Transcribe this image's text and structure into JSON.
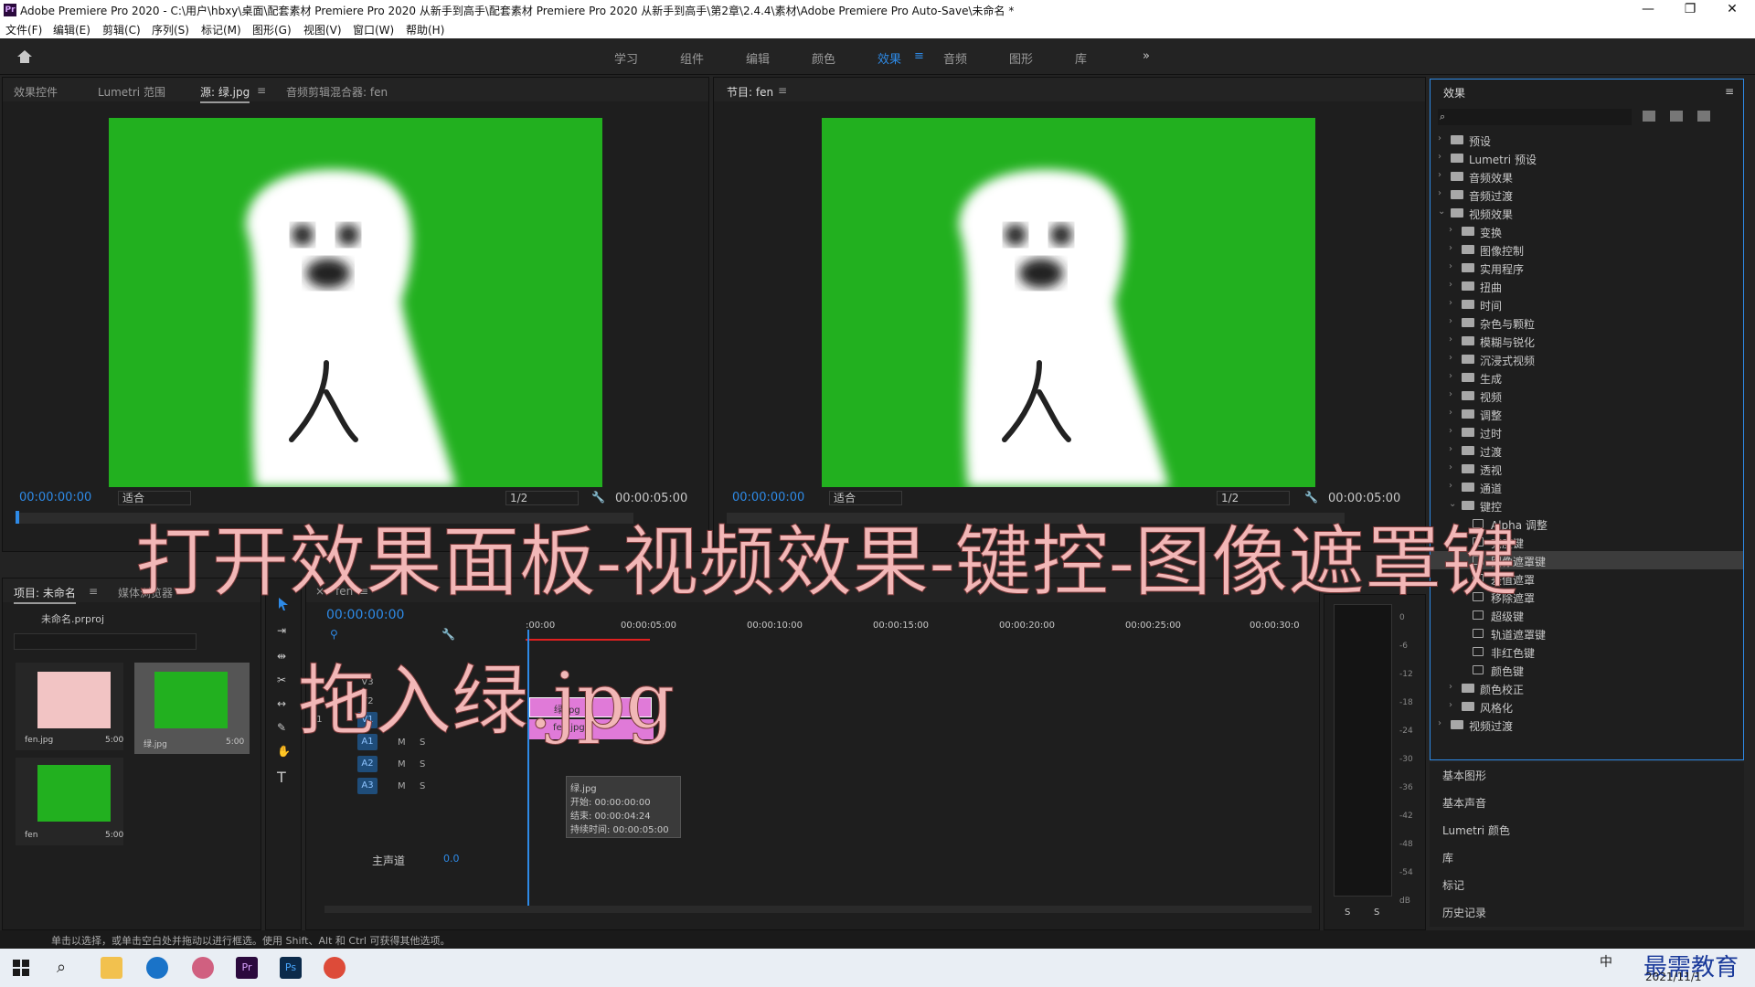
{
  "titlebar": {
    "title": "Adobe Premiere Pro 2020 - C:\\用户\\hbxy\\桌面\\配套素材 Premiere Pro 2020 从新手到高手\\配套素材 Premiere Pro 2020 从新手到高手\\第2章\\2.4.4\\素材\\Adobe Premiere Pro Auto-Save\\未命名 *",
    "logo": "Pr",
    "minimize": "—",
    "maximize": "❐",
    "close": "✕"
  },
  "menu": [
    "文件(F)",
    "编辑(E)",
    "剪辑(C)",
    "序列(S)",
    "标记(M)",
    "图形(G)",
    "视图(V)",
    "窗口(W)",
    "帮助(H)"
  ],
  "workspaces": {
    "items": [
      "学习",
      "组件",
      "编辑",
      "颜色",
      "效果",
      "音频",
      "图形",
      "库"
    ],
    "active": "效果",
    "more": "»"
  },
  "source_panel": {
    "tabs": [
      "效果控件",
      "Lumetri 范围",
      "源: 绿.jpg",
      "音频剪辑混合器: fen"
    ],
    "timecode": "00:00:00:00",
    "fit": "适合",
    "zoom": "1/2",
    "duration": "00:00:05:00"
  },
  "program_panel": {
    "tab": "节目: fen",
    "timecode": "00:00:00:00",
    "fit": "适合",
    "zoom": "1/2",
    "duration": "00:00:05:00"
  },
  "project_panel": {
    "tabs": [
      "项目: 未命名",
      "媒体浏览器"
    ],
    "file": "未命名.prproj",
    "items": [
      {
        "name": "fen.jpg",
        "dur": "5:00",
        "thumb": "#f2c4c4"
      },
      {
        "name": "绿.jpg",
        "dur": "5:00",
        "thumb": "#22b01f"
      },
      {
        "name": "fen",
        "dur": "5:00",
        "thumb": "#22b01f"
      }
    ]
  },
  "timeline": {
    "tab": "fen",
    "timecode": "00:00:00:00",
    "ruler": [
      ":00:00",
      "00:00:05:00",
      "00:00:10:00",
      "00:00:15:00",
      "00:00:20:00",
      "00:00:25:00",
      "00:00:30:0"
    ],
    "tracks_v": [
      "V3",
      "V2",
      "V1"
    ],
    "tracks_a": [
      "A1",
      "A2",
      "A3"
    ],
    "master": "主声道",
    "master_val": "0.0",
    "clip_v2": "绿.jpg",
    "clip_v1": "fen.jpg",
    "tooltip": {
      "name": "绿.jpg",
      "start": "开始: 00:00:00:00",
      "end": "结束: 00:00:04:24",
      "dur": "持续时间: 00:00:05:00"
    },
    "src_v1": "V1",
    "btn_m": "M",
    "btn_s": "S"
  },
  "meter": {
    "scale": [
      "0",
      "-6",
      "-12",
      "-18",
      "-24",
      "-30",
      "-36",
      "-42",
      "-48",
      "-54",
      "dB"
    ],
    "solo": [
      "S",
      "S"
    ]
  },
  "effects": {
    "title": "效果",
    "tree": [
      {
        "label": "预设",
        "level": 0,
        "arrow": "›",
        "kind": "folder"
      },
      {
        "label": "Lumetri 预设",
        "level": 0,
        "arrow": "›",
        "kind": "folder"
      },
      {
        "label": "音频效果",
        "level": 0,
        "arrow": "›",
        "kind": "folder"
      },
      {
        "label": "音频过渡",
        "level": 0,
        "arrow": "›",
        "kind": "folder"
      },
      {
        "label": "视频效果",
        "level": 0,
        "arrow": "⌄",
        "kind": "folder"
      },
      {
        "label": "变换",
        "level": 1,
        "arrow": "›",
        "kind": "folder"
      },
      {
        "label": "图像控制",
        "level": 1,
        "arrow": "›",
        "kind": "folder"
      },
      {
        "label": "实用程序",
        "level": 1,
        "arrow": "›",
        "kind": "folder"
      },
      {
        "label": "扭曲",
        "level": 1,
        "arrow": "›",
        "kind": "folder"
      },
      {
        "label": "时间",
        "level": 1,
        "arrow": "›",
        "kind": "folder"
      },
      {
        "label": "杂色与颗粒",
        "level": 1,
        "arrow": "›",
        "kind": "folder"
      },
      {
        "label": "模糊与锐化",
        "level": 1,
        "arrow": "›",
        "kind": "folder"
      },
      {
        "label": "沉浸式视频",
        "level": 1,
        "arrow": "›",
        "kind": "folder"
      },
      {
        "label": "生成",
        "level": 1,
        "arrow": "›",
        "kind": "folder"
      },
      {
        "label": "视频",
        "level": 1,
        "arrow": "›",
        "kind": "folder"
      },
      {
        "label": "调整",
        "level": 1,
        "arrow": "›",
        "kind": "folder"
      },
      {
        "label": "过时",
        "level": 1,
        "arrow": "›",
        "kind": "folder"
      },
      {
        "label": "过渡",
        "level": 1,
        "arrow": "›",
        "kind": "folder"
      },
      {
        "label": "透视",
        "level": 1,
        "arrow": "›",
        "kind": "folder"
      },
      {
        "label": "通道",
        "level": 1,
        "arrow": "›",
        "kind": "folder"
      },
      {
        "label": "键控",
        "level": 1,
        "arrow": "⌄",
        "kind": "folder"
      },
      {
        "label": "Alpha 调整",
        "level": 2,
        "arrow": "",
        "kind": "fx"
      },
      {
        "label": "亮度键",
        "level": 2,
        "arrow": "",
        "kind": "fx"
      },
      {
        "label": "图像遮罩键",
        "level": 2,
        "arrow": "",
        "kind": "fx",
        "selected": true
      },
      {
        "label": "差值遮罩",
        "level": 2,
        "arrow": "",
        "kind": "fx"
      },
      {
        "label": "移除遮罩",
        "level": 2,
        "arrow": "",
        "kind": "fx"
      },
      {
        "label": "超级键",
        "level": 2,
        "arrow": "",
        "kind": "fx"
      },
      {
        "label": "轨道遮罩键",
        "level": 2,
        "arrow": "",
        "kind": "fx"
      },
      {
        "label": "非红色键",
        "level": 2,
        "arrow": "",
        "kind": "fx"
      },
      {
        "label": "颜色键",
        "level": 2,
        "arrow": "",
        "kind": "fx"
      },
      {
        "label": "颜色校正",
        "level": 1,
        "arrow": "›",
        "kind": "folder"
      },
      {
        "label": "风格化",
        "level": 1,
        "arrow": "›",
        "kind": "folder"
      },
      {
        "label": "视频过渡",
        "level": 0,
        "arrow": "›",
        "kind": "folder"
      }
    ],
    "collapsed_panels": [
      "基本图形",
      "基本声音",
      "Lumetri 颜色",
      "库",
      "标记",
      "历史记录"
    ]
  },
  "status": "单击以选择，或单击空白处并拖动以进行框选。使用 Shift、Alt 和 Ctrl 可获得其他选项。",
  "overlay": {
    "line1": "打开效果面板-视频效果-键控-图像遮罩键",
    "line2": "拖入绿.jpg"
  },
  "taskbar": {
    "date": "2021/11/1",
    "watermark": "最需教育",
    "ime": "中"
  },
  "colors": {
    "accent": "#2e8ae6",
    "green_screen": "#22b01f",
    "clip_pink": "#e07ad8"
  }
}
